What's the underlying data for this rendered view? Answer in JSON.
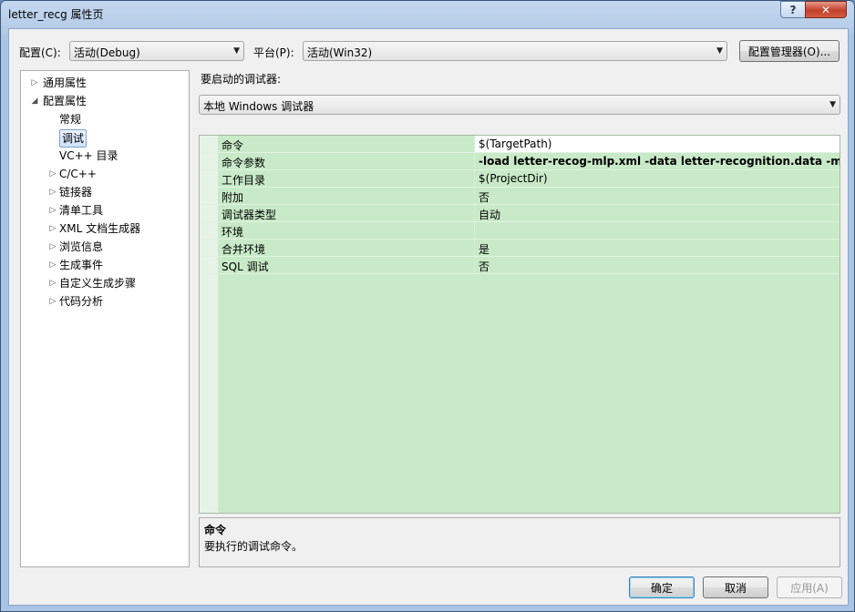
{
  "window": {
    "title": "letter_recg 属性页",
    "help_glyph": "?",
    "close_glyph": "✕"
  },
  "config": {
    "label": "配置(C):",
    "value": "活动(Debug)"
  },
  "platform": {
    "label": "平台(P):",
    "value": "活动(Win32)"
  },
  "config_manager_label": "配置管理器(O)...",
  "tree": [
    {
      "label": "通用属性",
      "expander": "▷",
      "depth": 0,
      "selected": false
    },
    {
      "label": "配置属性",
      "expander": "◢",
      "depth": 0,
      "selected": false
    },
    {
      "label": "常规",
      "expander": "",
      "depth": 1,
      "selected": false
    },
    {
      "label": "调试",
      "expander": "",
      "depth": 1,
      "selected": true
    },
    {
      "label": "VC++ 目录",
      "expander": "",
      "depth": 1,
      "selected": false
    },
    {
      "label": "C/C++",
      "expander": "▷",
      "depth": 1,
      "selected": false
    },
    {
      "label": "链接器",
      "expander": "▷",
      "depth": 1,
      "selected": false
    },
    {
      "label": "清单工具",
      "expander": "▷",
      "depth": 1,
      "selected": false
    },
    {
      "label": "XML 文档生成器",
      "expander": "▷",
      "depth": 1,
      "selected": false
    },
    {
      "label": "浏览信息",
      "expander": "▷",
      "depth": 1,
      "selected": false
    },
    {
      "label": "生成事件",
      "expander": "▷",
      "depth": 1,
      "selected": false
    },
    {
      "label": "自定义生成步骤",
      "expander": "▷",
      "depth": 1,
      "selected": false
    },
    {
      "label": "代码分析",
      "expander": "▷",
      "depth": 1,
      "selected": false
    }
  ],
  "debugger": {
    "label": "要启动的调试器:",
    "value": "本地 Windows 调试器"
  },
  "properties": [
    {
      "name": "命令",
      "value": "$(TargetPath)",
      "bold": false
    },
    {
      "name": "命令参数",
      "value": "-load  letter-recog-mlp.xml -data letter-recognition.data -mlp -sa",
      "bold": true
    },
    {
      "name": "工作目录",
      "value": "$(ProjectDir)",
      "bold": false
    },
    {
      "name": "附加",
      "value": "否",
      "bold": false
    },
    {
      "name": "调试器类型",
      "value": "自动",
      "bold": false
    },
    {
      "name": "环境",
      "value": "",
      "bold": false
    },
    {
      "name": "合并环境",
      "value": "是",
      "bold": false
    },
    {
      "name": "SQL 调试",
      "value": "否",
      "bold": false
    }
  ],
  "description": {
    "title": "命令",
    "text": "要执行的调试命令。"
  },
  "buttons": {
    "ok": "确定",
    "cancel": "取消",
    "apply": "应用(A)"
  },
  "icons": {
    "dropdown_arrow": "▼"
  }
}
